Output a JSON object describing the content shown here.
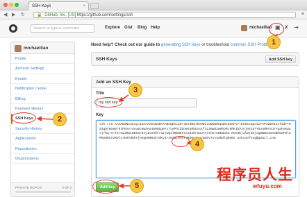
{
  "browser": {
    "tab_title": "SSH Keys",
    "tab_close": "×",
    "back": "◀",
    "forward": "▶",
    "reload": "↻",
    "lock": "🔒",
    "url_host": "GitHub, Inc. [US]",
    "url_path": "https://github.com/settings/ssh",
    "menu": "≡"
  },
  "header": {
    "search_placeholder": "Search or type a command",
    "nav": [
      "Explore",
      "Gist",
      "Blog",
      "Help"
    ],
    "username": "michaelliao"
  },
  "sidebar": {
    "username": "michaelliao",
    "items": [
      {
        "label": "Profile"
      },
      {
        "label": "Account Settings"
      },
      {
        "label": "Emails"
      },
      {
        "label": "Notification Center"
      },
      {
        "label": "Billing"
      },
      {
        "label": "Payment History"
      },
      {
        "label": "SSH Keys",
        "active": true
      },
      {
        "label": "Security History"
      },
      {
        "label": "Applications"
      },
      {
        "label": "Repositories"
      },
      {
        "label": "Organizations"
      }
    ],
    "footer_label": "PRIVATE REPOS",
    "footer_count": "0 OF 0",
    "private_repos_fraction": 0
  },
  "main": {
    "help_prefix": "Need help? Check out our guide to",
    "help_link1": "generating SSH keys",
    "help_middle": "or troubleshoot",
    "help_link2": "common SSH Problems",
    "ssh_keys_title": "SSH Keys",
    "add_ssh_key_button": "Add SSH key",
    "form_title": "Add an SSH Key",
    "title_label": "Title",
    "title_value": "my ssh key",
    "key_label": "Key",
    "key_value": "ssh-rsa AAAAB3NzaC1yc2EAAAADAQABAAABAQDsLpd+xEzHWS7heMULvq9wwHHpqRxbpwFyF+ECIExQpoicFAP4wEKI1sf3dYYHZ4gHtNowRr9IPGVy7aVumc6wSAn4mMUDgeFxltePhtZbnWYqHbGxxxf1zzBwd3w0hDRj5Nk1bVJAjeE18TY6xUMNYzUYYgahv0Uasj/Gq+s+TX/G2JR8LDE6sFKsyIxo9hf/32jCQ3l0BmRtssxBJhrGUJATxYnErnBb8b8u ReV3Ej1lDjdKjxgDWW34aewdM8aFDlXMhmHbCCvRwlyJGHVdDhYjAOgK0HB3CYdKyirI83SjOcOYvROQgavuvm3Dv7xy4dNdlQb6Bz askxuefeng@gmail.com",
    "add_key_button": "Add key"
  },
  "annotations": [
    "1",
    "2",
    "3",
    "4",
    "5"
  ],
  "watermark": {
    "text": "程序员人生",
    "url": "wfuyu.com"
  },
  "colors": {
    "badge_fill": "#f6c644",
    "marker": "#e23b24",
    "link": "#4183c4",
    "add_button": "#60b044",
    "watermark": "#e0281a"
  }
}
